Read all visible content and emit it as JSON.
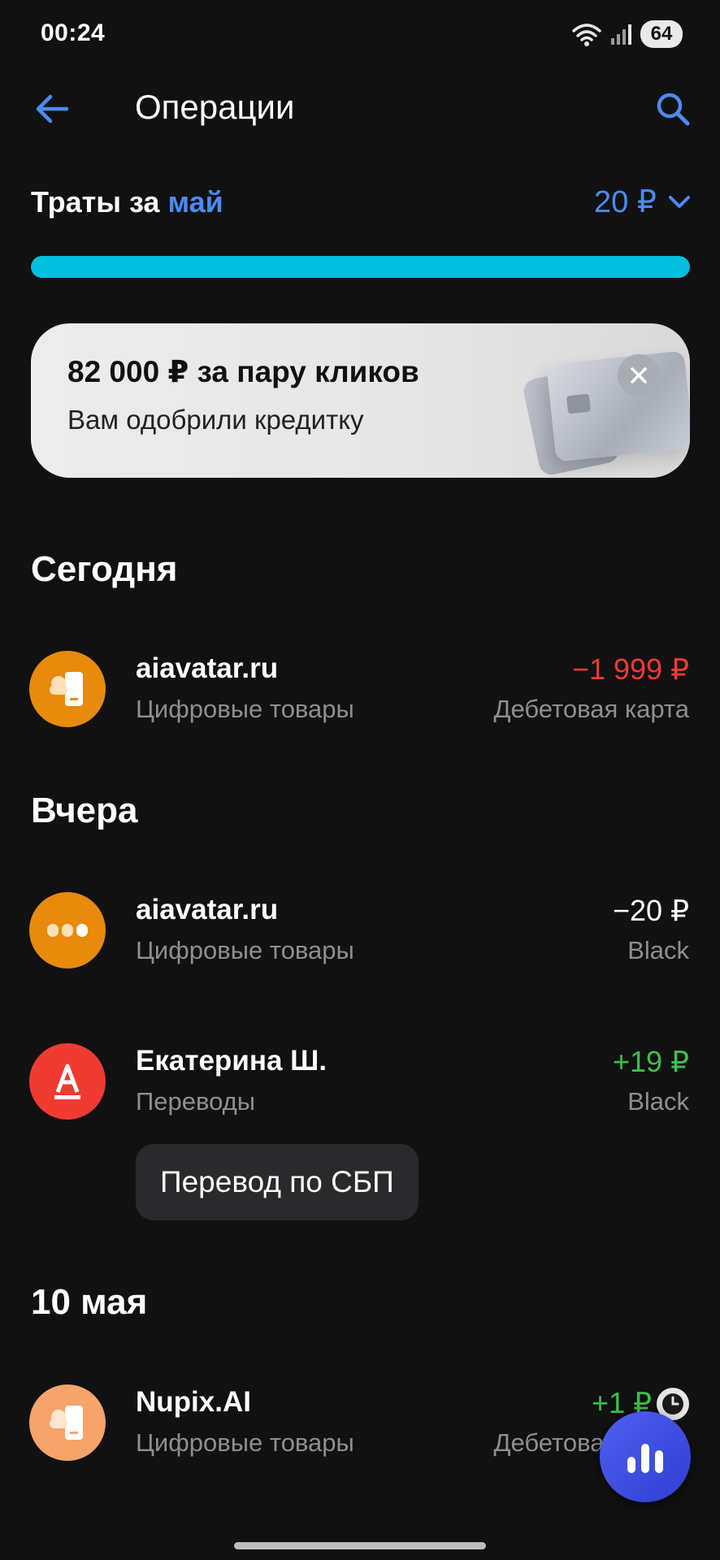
{
  "status_bar": {
    "time": "00:24",
    "battery": "64"
  },
  "header": {
    "title": "Операции",
    "back_icon": "arrow-left-icon",
    "search_icon": "search-icon"
  },
  "spending": {
    "label": "Траты за",
    "month": "май",
    "amount": "20 ₽",
    "progress_percent": 100,
    "progress_color": "#00bfde"
  },
  "promo": {
    "title": "82 000 ₽ за пару кликов",
    "subtitle": "Вам одобрили кредитку"
  },
  "sections": {
    "today": "Сегодня",
    "yesterday": "Вчера",
    "may10": "10 мая"
  },
  "operations": [
    {
      "title": "aiavatar.ru",
      "category": "Цифровые товары",
      "amount": "−1 999 ₽",
      "account": "Дебетовая карта",
      "avatar_color": "#e88a0b",
      "icon": "digital-goods-icon"
    },
    {
      "title": "aiavatar.ru",
      "category": "Цифровые товары",
      "amount": "−20 ₽",
      "account": "Black",
      "avatar_color": "#e88a0b",
      "icon": "dots-icon"
    },
    {
      "title": "Екатерина Ш.",
      "category": "Переводы",
      "amount": "+19 ₽",
      "account": "Black",
      "avatar_color": "#ef3b32",
      "icon": "alfa-logo-icon",
      "chip": "Перевод по СБП"
    },
    {
      "title": "Nupix.AI",
      "category": "Цифровые товары",
      "amount": "+1 ₽",
      "account": "Дебетовая карта",
      "avatar_color": "#f6a46a",
      "icon": "digital-goods-icon"
    }
  ],
  "colors": {
    "accent": "#4a8bf2",
    "negative": "#ef3b32",
    "positive": "#3fbe4c",
    "background": "#111112"
  }
}
